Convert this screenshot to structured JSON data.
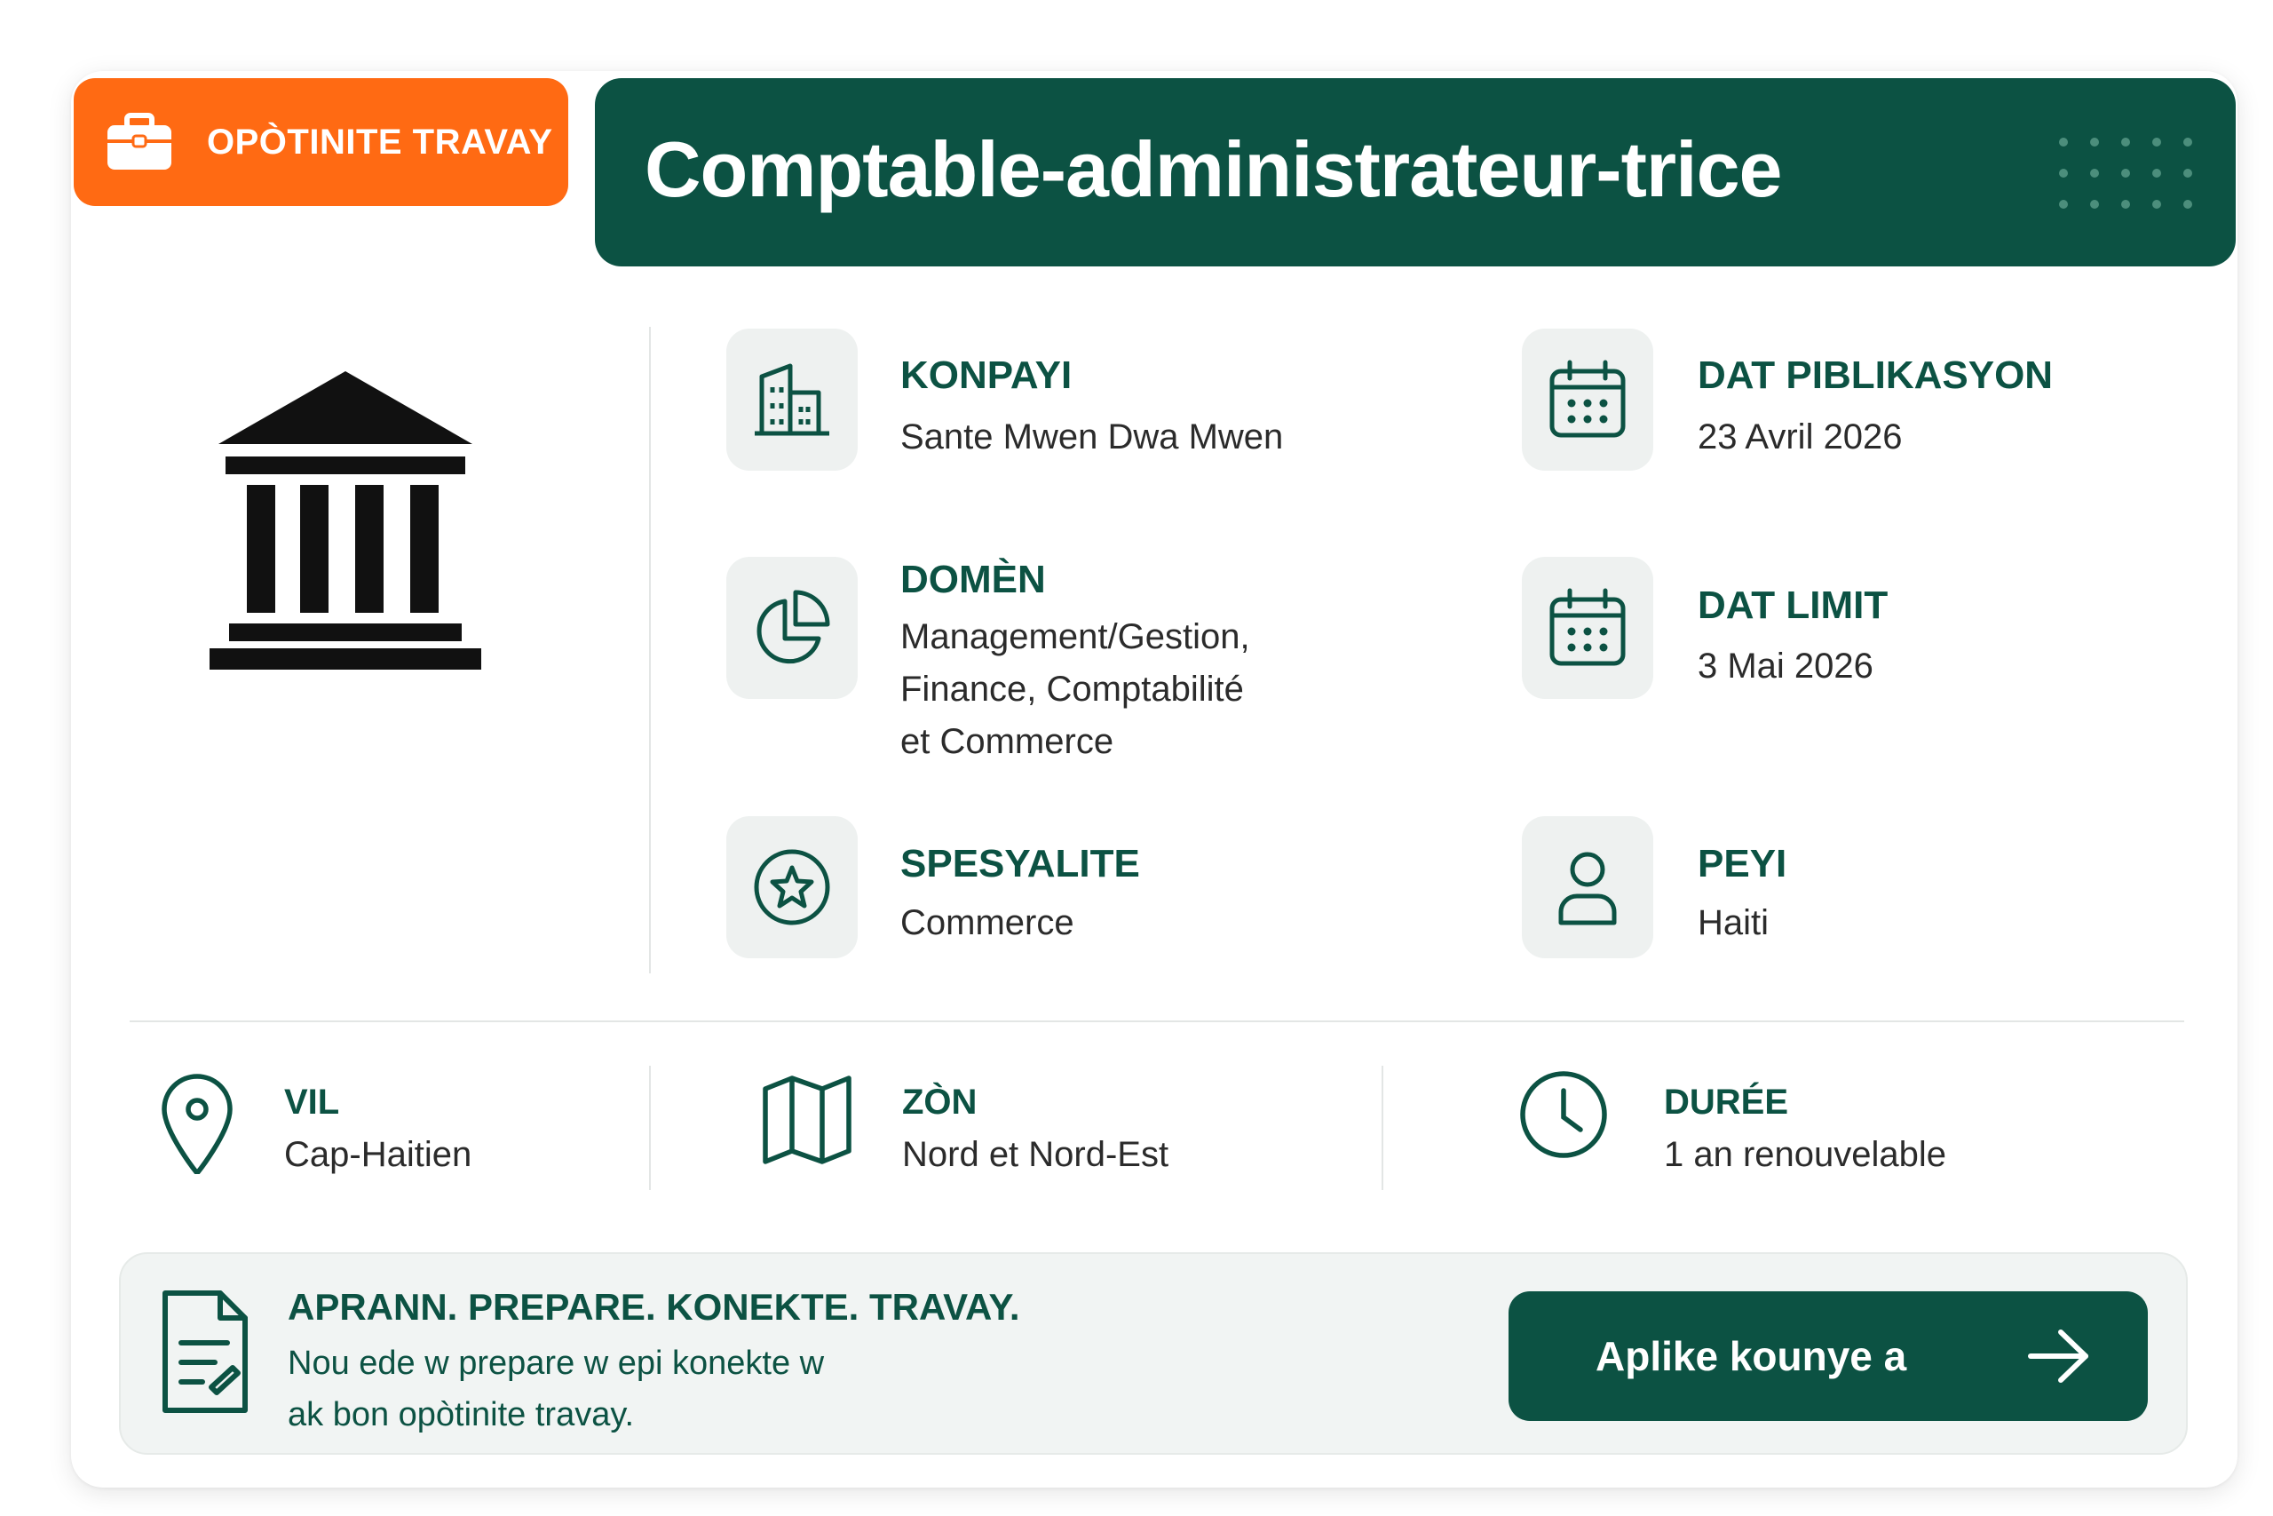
{
  "badge": {
    "label": "OPÒTINITE TRAVAY",
    "icon": "briefcase-icon",
    "color": "#ff6a13"
  },
  "header": {
    "title": "Comptable-administrateur-trice",
    "color": "#0c5243",
    "decoration": "dot-grid-icon"
  },
  "logo": {
    "icon": "government-building-icon"
  },
  "details": {
    "company": {
      "label": "KONPAYI",
      "value": "Sante Mwen Dwa Mwen",
      "icon": "office-building-icon"
    },
    "published": {
      "label": "DAT PIBLIKASYON",
      "value": "23 Avril 2026",
      "icon": "calendar-icon"
    },
    "domain": {
      "label": "DOMÈN",
      "value_lines": [
        "Management/Gestion,",
        "Finance, Comptabilité",
        "et Commerce"
      ],
      "icon": "pie-chart-icon"
    },
    "deadline": {
      "label": "DAT LIMIT",
      "value": "3 Mai 2026",
      "icon": "calendar-icon"
    },
    "specialty": {
      "label": "SPESYALITE",
      "value": "Commerce",
      "icon": "star-badge-icon"
    },
    "country": {
      "label": "PEYI",
      "value": "Haiti",
      "icon": "person-icon"
    }
  },
  "location": {
    "city": {
      "label": "VIL",
      "value": "Cap-Haitien",
      "icon": "map-pin-icon"
    },
    "zone": {
      "label": "ZÒN",
      "value": "Nord et Nord-Est",
      "icon": "folded-map-icon"
    },
    "duration": {
      "label": "DURÉE",
      "value": "1 an renouvelable",
      "icon": "clock-icon"
    }
  },
  "banner": {
    "heading": "APRANN. PREPARE. KONEKTE. TRAVAY.",
    "sub_lines": [
      "Nou ede w prepare w epi konekte w",
      "ak bon opòtinite travay."
    ],
    "icon": "document-icon",
    "apply_label": "Aplike kounye a",
    "apply_icon": "arrow-right-icon"
  },
  "colors": {
    "accent_green": "#0c5243",
    "orange": "#ff6a13",
    "tile_bg": "#eef1f0"
  }
}
